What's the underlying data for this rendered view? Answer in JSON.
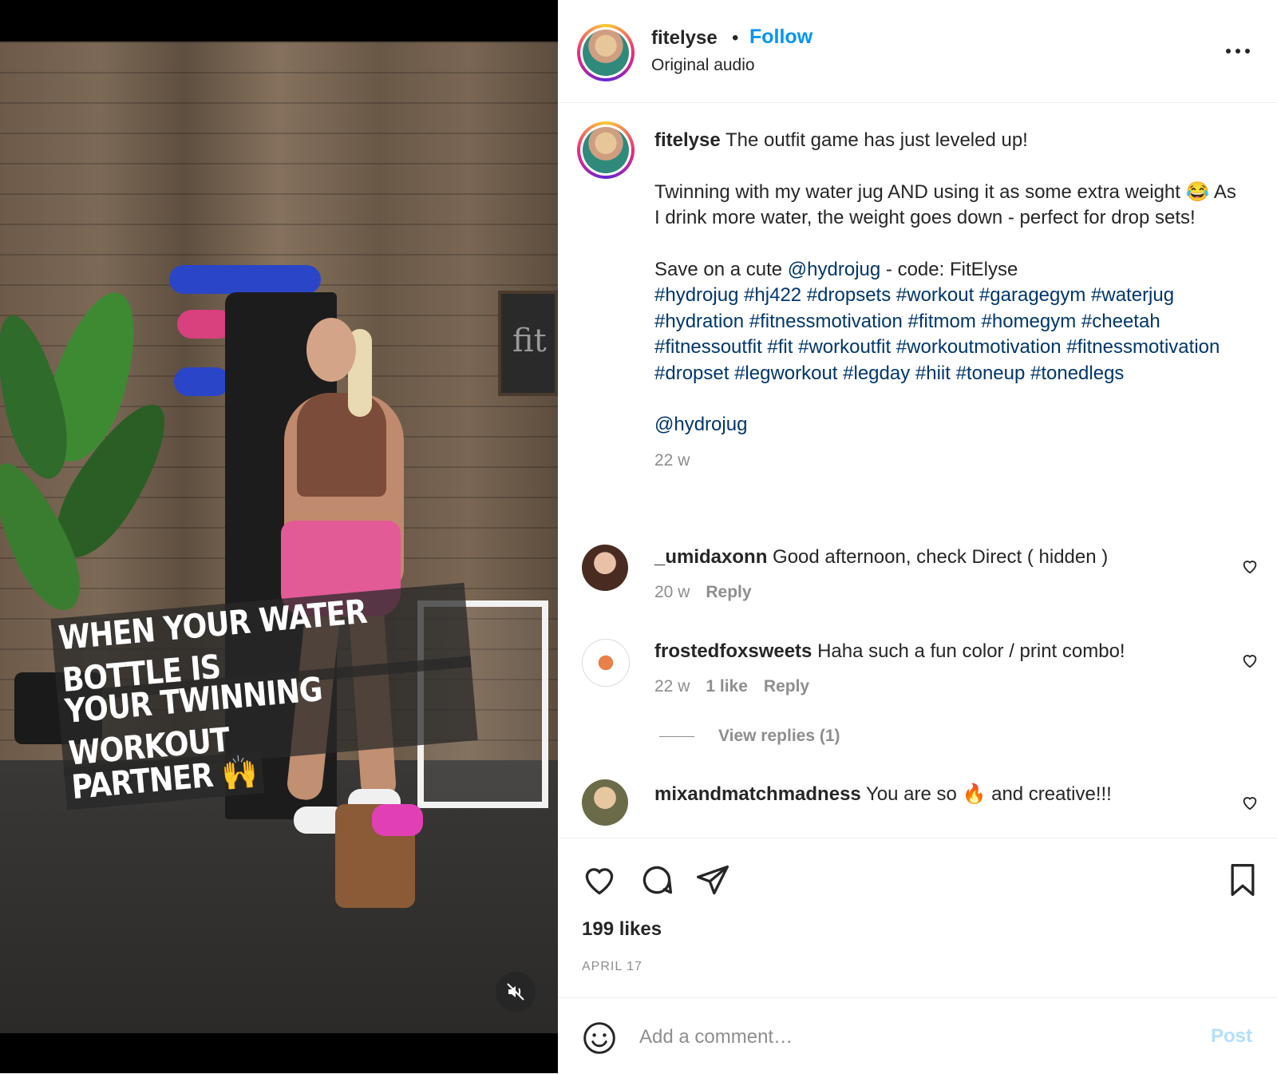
{
  "video": {
    "overlay_lines": [
      "WHEN YOUR WATER BOTTLE IS",
      "YOUR TWINNING WORKOUT",
      "PARTNER 🙌"
    ],
    "board_text": "fit",
    "mute_icon": "speaker-muted-icon"
  },
  "header": {
    "username": "fitelyse",
    "separator": "•",
    "follow_label": "Follow",
    "audio": "Original audio",
    "more_icon": "more-options-icon"
  },
  "caption": {
    "username": "fitelyse",
    "line1": "The outfit game has just leveled up!",
    "para2": "Twinning with my water jug AND using it as some extra weight 😂 As I drink more water, the weight goes down - perfect for drop sets!",
    "save_prefix": "Save on a cute",
    "save_mention": "@hydrojug",
    "save_suffix": "- code: FitElyse",
    "hashtags": "#hydrojug #hj422 #dropsets #workout #garagegym #waterjug #hydration #fitnessmotivation #fitmom #homegym #cheetah #fitnessoutfit #fit #workoutfit #workoutmotivation #fitnessmotivation #dropset #legworkout #legday #hiit #toneup #tonedlegs",
    "mention": "@hydrojug",
    "age": "22 w"
  },
  "comments": [
    {
      "username": "_umidaxonn",
      "text": "Good afternoon, check Direct ( hidden )",
      "age": "20 w",
      "likes": "",
      "reply": "Reply"
    },
    {
      "username": "frostedfoxsweets",
      "text": "Haha such a fun color / print combo!",
      "age": "22 w",
      "likes": "1 like",
      "reply": "Reply",
      "view_replies": "View replies (1)"
    },
    {
      "username": "mixandmatchmadness",
      "text": "You are so 🔥 and creative!!!"
    }
  ],
  "actions": {
    "likes": "199 likes",
    "date": "APRIL 17"
  },
  "add_comment": {
    "placeholder": "Add a comment…",
    "post_label": "Post"
  },
  "colors": {
    "accent": "#0095f6",
    "link": "#00376b",
    "muted": "#8e8e8e",
    "post_disabled": "#b2dffc"
  }
}
